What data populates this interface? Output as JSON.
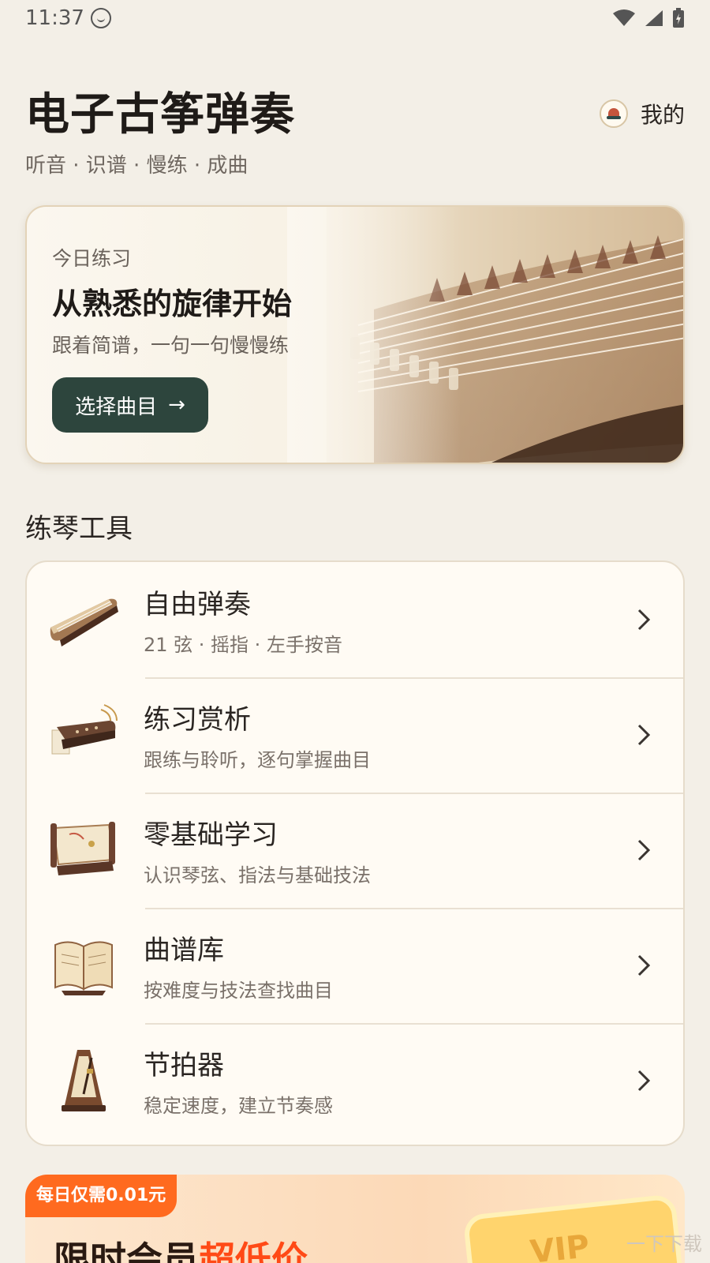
{
  "status_bar": {
    "time": "11:37"
  },
  "header": {
    "title": "电子古筝弹奏",
    "subtitle": "听音 · 识谱 · 慢练 · 成曲",
    "profile_label": "我的"
  },
  "hero": {
    "eyebrow": "今日练习",
    "title": "从熟悉的旋律开始",
    "description": "跟着简谱，一句一句慢慢练",
    "button_label": "选择曲目",
    "button_arrow": "→"
  },
  "tools_section": {
    "title": "练琴工具",
    "items": [
      {
        "title": "自由弹奏",
        "desc": "21 弦 · 摇指 · 左手按音",
        "icon": "guzheng-icon"
      },
      {
        "title": "练习赏析",
        "desc": "跟练与聆听，逐句掌握曲目",
        "icon": "guzheng-sound-icon"
      },
      {
        "title": "零基础学习",
        "desc": "认识琴弦、指法与基础技法",
        "icon": "scroll-icon"
      },
      {
        "title": "曲谱库",
        "desc": "按难度与技法查找曲目",
        "icon": "book-icon"
      },
      {
        "title": "节拍器",
        "desc": "稳定速度，建立节奏感",
        "icon": "metronome-icon"
      }
    ]
  },
  "promo": {
    "badge": "每日仅需0.01元",
    "headline_a": "限时会员",
    "headline_b": "超低价",
    "card_text": "VIP"
  },
  "watermark": "一下下载",
  "colors": {
    "background": "#f3efe7",
    "primary_button": "#2d453d",
    "promo_accent": "#ff6a1f"
  }
}
